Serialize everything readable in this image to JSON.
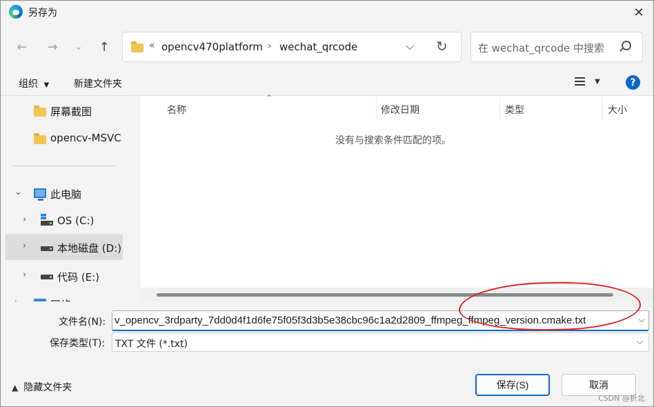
{
  "window": {
    "title": "另存为"
  },
  "nav": {
    "breadcrumb": [
      "opencv470platform",
      "wechat_qrcode"
    ],
    "overflow": "«",
    "search_placeholder": "在 wechat_qrcode 中搜索"
  },
  "toolbar": {
    "organize": "组织",
    "new_folder": "新建文件夹"
  },
  "sidebar": {
    "items": [
      {
        "label": "屏幕截图"
      },
      {
        "label": "opencv-MSVC"
      },
      {
        "label": "此电脑"
      },
      {
        "label": "OS (C:)"
      },
      {
        "label": "本地磁盘 (D:)"
      },
      {
        "label": "代码 (E:)"
      },
      {
        "label": "网络"
      }
    ]
  },
  "columns": [
    "名称",
    "修改日期",
    "类型",
    "大小"
  ],
  "empty_message": "没有与搜索条件匹配的项。",
  "form": {
    "filename_label": "文件名(N):",
    "filename_value": "v_opencv_3rdparty_7dd0d4f1d6fe75f05f3d3b5e38cbc96c1a2d2809_ffmpeg_ffmpeg_version.cmake.txt",
    "filetype_label": "保存类型(T):",
    "filetype_value": "TXT 文件 (*.txt)"
  },
  "footer": {
    "hide_folders": "隐藏文件夹",
    "save": "保存(S)",
    "cancel": "取消"
  },
  "watermark": "CSDN @折北",
  "colors": {
    "accent": "#0a66c8",
    "annotation": "#e02020",
    "folder": "#f2c451"
  }
}
